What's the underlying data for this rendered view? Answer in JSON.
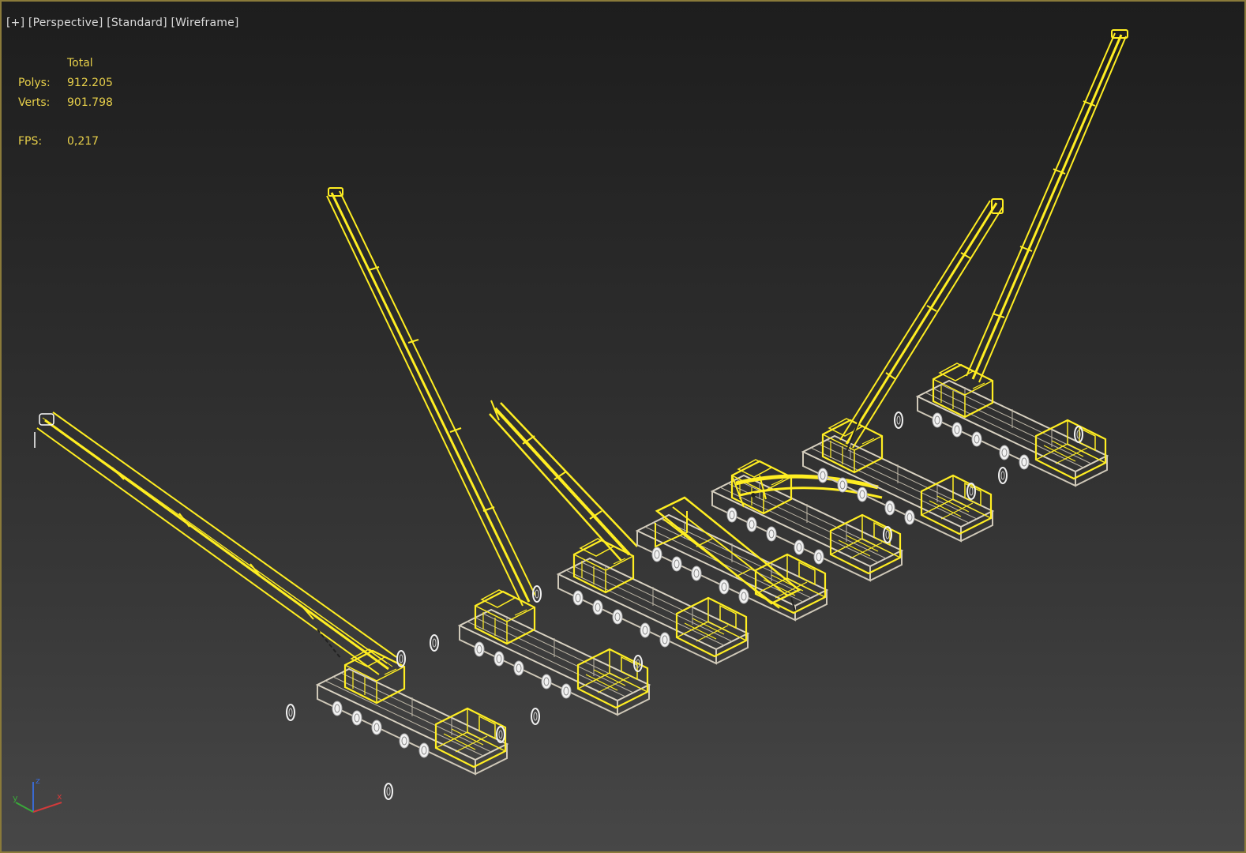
{
  "viewport": {
    "labels": {
      "menu": "[+]",
      "view": "[Perspective]",
      "shading_style": "[Standard]",
      "render_mode": "[Wireframe]"
    },
    "stats": {
      "column_header": "Total",
      "polys_label": "Polys:",
      "polys_value": "912.205",
      "verts_label": "Verts:",
      "verts_value": "901.798",
      "fps_label": "FPS:",
      "fps_value": "0,217"
    },
    "gizmo": {
      "x_label": "x",
      "y_label": "y",
      "z_label": "z"
    },
    "colors": {
      "wire_selected": "#ffee22",
      "wire_body": "#d9d2c2",
      "wheel": "#f0f0f0",
      "stats_text": "#e8d04a",
      "label_text": "#d9d9d9",
      "axis_x": "#d23a3a",
      "axis_y": "#3aa83a",
      "axis_z": "#3a6ad2"
    }
  }
}
